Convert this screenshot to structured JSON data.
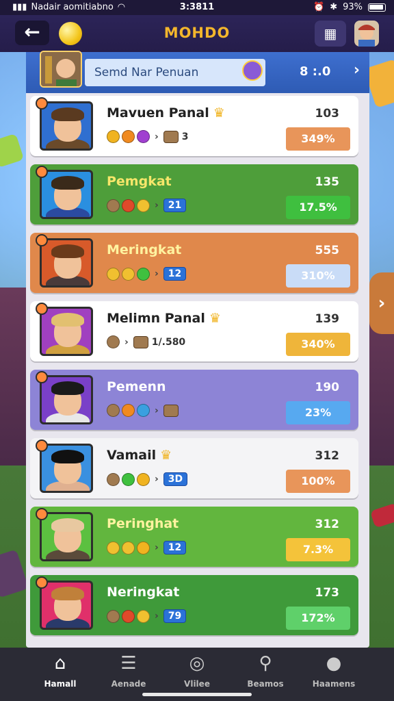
{
  "status_bar": {
    "carrier": "Nadair aomitiabno",
    "time": "3:3811",
    "battery": "93%"
  },
  "nav": {
    "title": "MOHDO",
    "back_icon": "arrow-left-icon",
    "hint_icon": "lightbulb-icon",
    "gift_icon": "gift-icon",
    "profile_icon": "avatar-icon"
  },
  "header": {
    "field_text": "Semd Nar Penuan",
    "score": "8 :.0",
    "chevron": "›"
  },
  "rows": [
    {
      "name": "Mavuen Panal",
      "star": true,
      "score": "103",
      "note": "3",
      "tag": "",
      "pct": "349%",
      "pct_color": "#e8955a",
      "bg": "#ffffff",
      "name_color": "#222"
    },
    {
      "name": "Pemgkat",
      "star": false,
      "score": "135",
      "note": "",
      "tag": "21",
      "pct": "17.5%",
      "pct_color": "#3fbf3f",
      "bg": "#4e9e3a",
      "name_color": "#f6e66a"
    },
    {
      "name": "Meringkat",
      "star": false,
      "score": "555",
      "note": "",
      "tag": "12",
      "pct": "310%",
      "pct_color": "#c9dcf7",
      "bg": "#e0884b",
      "name_color": "#fff3a0"
    },
    {
      "name": "Melimn Panal",
      "star": true,
      "score": "139",
      "note": "1/.580",
      "tag": "",
      "pct": "340%",
      "pct_color": "#efb53a",
      "bg": "#ffffff",
      "name_color": "#222"
    },
    {
      "name": "Pemenn",
      "star": false,
      "score": "190",
      "note": "",
      "tag": "",
      "pct": "23%",
      "pct_color": "#57a9f0",
      "bg": "#8d84d6",
      "name_color": "#ffffff"
    },
    {
      "name": "Vamail",
      "star": true,
      "score": "312",
      "note": "",
      "tag": "3D",
      "pct": "100%",
      "pct_color": "#e8955a",
      "bg": "#f4f4f6",
      "name_color": "#222"
    },
    {
      "name": "Peringhat",
      "star": false,
      "score": "312",
      "note": "",
      "tag": "12",
      "pct": "7.3%",
      "pct_color": "#f4c33a",
      "bg": "#62b63e",
      "name_color": "#fff3a0"
    },
    {
      "name": "Neringkat",
      "star": false,
      "score": "173",
      "note": "",
      "tag": "79",
      "pct": "172%",
      "pct_color": "#5fd06a",
      "bg": "#3f9a3a",
      "name_color": "#ffffff"
    }
  ],
  "tabs": [
    {
      "label": "Hamall",
      "icon": "home-icon",
      "glyph": "⌂",
      "active": true
    },
    {
      "label": "Aenade",
      "icon": "list-icon",
      "glyph": "☰",
      "active": false
    },
    {
      "label": "Vlilee",
      "icon": "target-icon",
      "glyph": "◎",
      "active": false
    },
    {
      "label": "Beamos",
      "icon": "search-icon",
      "glyph": "⚲",
      "active": false
    },
    {
      "label": "Haamens",
      "icon": "profile-icon",
      "glyph": "●",
      "active": false
    }
  ]
}
